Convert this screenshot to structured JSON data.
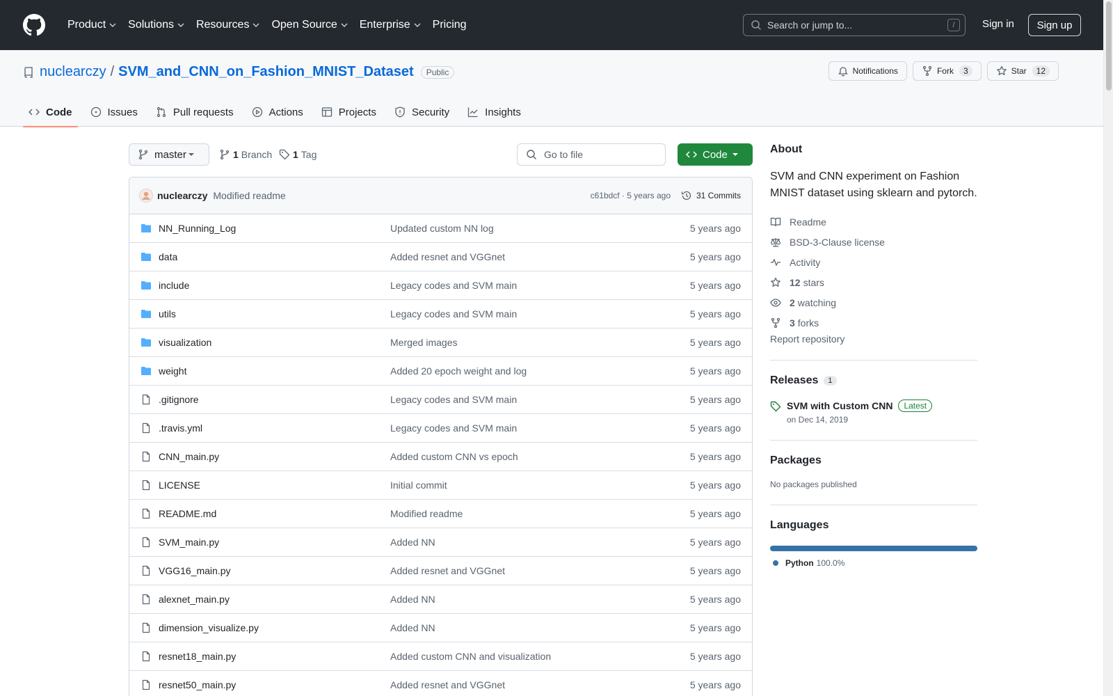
{
  "header": {
    "nav": [
      "Product",
      "Solutions",
      "Resources",
      "Open Source",
      "Enterprise",
      "Pricing"
    ],
    "search_placeholder": "Search or jump to...",
    "search_shortcut": "/",
    "sign_in": "Sign in",
    "sign_up": "Sign up"
  },
  "repo": {
    "owner": "nuclearczy",
    "separator": "/",
    "name": "SVM_and_CNN_on_Fashion_MNIST_Dataset",
    "visibility": "Public",
    "notifications_label": "Notifications",
    "fork_label": "Fork",
    "fork_count": "3",
    "star_label": "Star",
    "star_count": "12"
  },
  "tabs": [
    "Code",
    "Issues",
    "Pull requests",
    "Actions",
    "Projects",
    "Security",
    "Insights"
  ],
  "toolbar": {
    "branch": "master",
    "branch_count": "1",
    "branch_label": "Branch",
    "tag_count": "1",
    "tag_label": "Tag",
    "goto_placeholder": "Go to file",
    "code_label": "Code"
  },
  "commit": {
    "author": "nuclearczy",
    "message": "Modified readme",
    "meta": "c61bdcf · 5 years ago",
    "commits": "31 Commits"
  },
  "files": [
    {
      "name": "NN_Running_Log",
      "type": "dir",
      "message": "Updated custom NN log",
      "age": "5 years ago"
    },
    {
      "name": "data",
      "type": "dir",
      "message": "Added resnet and VGGnet",
      "age": "5 years ago"
    },
    {
      "name": "include",
      "type": "dir",
      "message": "Legacy codes and SVM main",
      "age": "5 years ago"
    },
    {
      "name": "utils",
      "type": "dir",
      "message": "Legacy codes and SVM main",
      "age": "5 years ago"
    },
    {
      "name": "visualization",
      "type": "dir",
      "message": "Merged images",
      "age": "5 years ago"
    },
    {
      "name": "weight",
      "type": "dir",
      "message": "Added 20 epoch weight and log",
      "age": "5 years ago"
    },
    {
      "name": ".gitignore",
      "type": "file",
      "message": "Legacy codes and SVM main",
      "age": "5 years ago"
    },
    {
      "name": ".travis.yml",
      "type": "file",
      "message": "Legacy codes and SVM main",
      "age": "5 years ago"
    },
    {
      "name": "CNN_main.py",
      "type": "file",
      "message": "Added custom CNN vs epoch",
      "age": "5 years ago"
    },
    {
      "name": "LICENSE",
      "type": "file",
      "message": "Initial commit",
      "age": "5 years ago"
    },
    {
      "name": "README.md",
      "type": "file",
      "message": "Modified readme",
      "age": "5 years ago"
    },
    {
      "name": "SVM_main.py",
      "type": "file",
      "message": "Added NN",
      "age": "5 years ago"
    },
    {
      "name": "VGG16_main.py",
      "type": "file",
      "message": "Added resnet and VGGnet",
      "age": "5 years ago"
    },
    {
      "name": "alexnet_main.py",
      "type": "file",
      "message": "Added NN",
      "age": "5 years ago"
    },
    {
      "name": "dimension_visualize.py",
      "type": "file",
      "message": "Added NN",
      "age": "5 years ago"
    },
    {
      "name": "resnet18_main.py",
      "type": "file",
      "message": "Added custom CNN and visualization",
      "age": "5 years ago"
    },
    {
      "name": "resnet50_main.py",
      "type": "file",
      "message": "Added resnet and VGGnet",
      "age": "5 years ago"
    }
  ],
  "about": {
    "title": "About",
    "description": "SVM and CNN experiment on Fashion MNIST dataset using sklearn and pytorch.",
    "readme": "Readme",
    "license": "BSD-3-Clause license",
    "activity": "Activity",
    "stars_count": "12",
    "stars_label": "stars",
    "watching_count": "2",
    "watching_label": "watching",
    "forks_count": "3",
    "forks_label": "forks",
    "report": "Report repository"
  },
  "releases": {
    "title": "Releases",
    "count": "1",
    "name": "SVM with Custom CNN",
    "badge": "Latest",
    "date": "on Dec 14, 2019"
  },
  "packages": {
    "title": "Packages",
    "text": "No packages published"
  },
  "languages": {
    "title": "Languages",
    "name": "Python",
    "percent": "100.0%",
    "color": "#3572a5"
  },
  "colors": {
    "header_bg": "#24292f",
    "link": "#0969da",
    "primary_button": "#1f883d",
    "active_tab_underline": "#fd8c73",
    "folder_icon": "#54aeff"
  }
}
